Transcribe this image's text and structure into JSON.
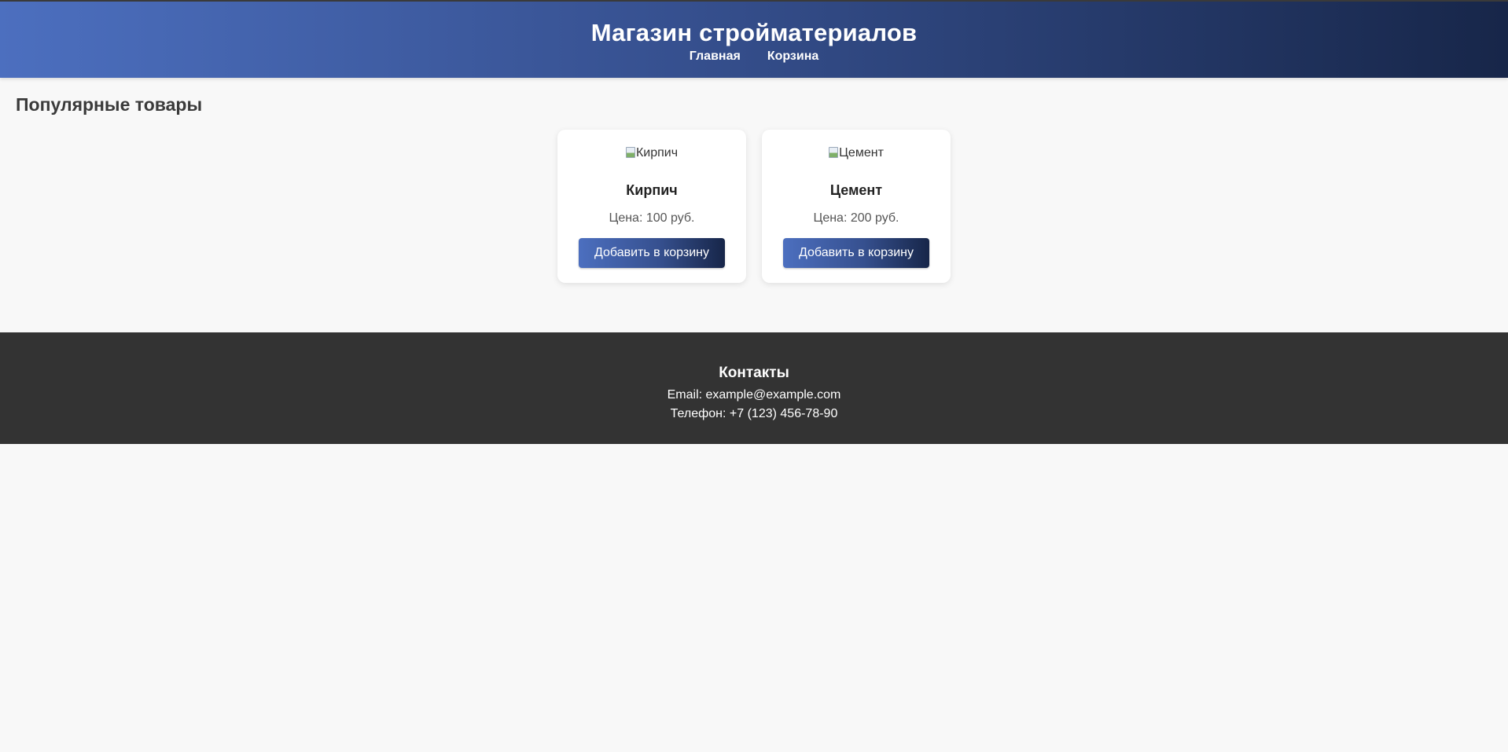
{
  "header": {
    "title": "Магазин стройматериалов",
    "nav": [
      {
        "label": "Главная"
      },
      {
        "label": "Корзина"
      }
    ],
    "gradient_colors": [
      "#4c6fbf",
      "#172649"
    ]
  },
  "main": {
    "section_title": "Популярные товары",
    "products": [
      {
        "image_alt": "Кирпич",
        "name": "Кирпич",
        "price": "Цена: 100 руб.",
        "button_label": "Добавить в корзину"
      },
      {
        "image_alt": "Цемент",
        "name": "Цемент",
        "price": "Цена: 200 руб.",
        "button_label": "Добавить в корзину"
      }
    ]
  },
  "footer": {
    "title": "Контакты",
    "email": "Email: example@example.com",
    "phone": "Телефон: +7 (123) 456-78-90",
    "background": "#333333"
  },
  "icons": {
    "product_image": "broken-image-icon"
  }
}
